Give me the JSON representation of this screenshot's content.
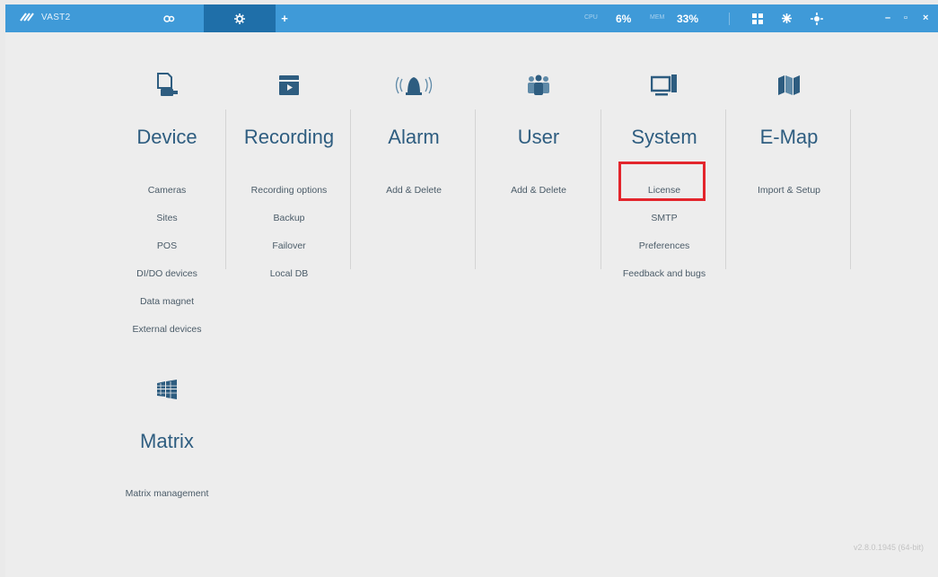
{
  "titlebar": {
    "app_name": "VAST2",
    "cpu_label": "CPU",
    "cpu_value": "6%",
    "mem_label": "MEM",
    "mem_value": "33%",
    "minimize": "–",
    "maximize": "▫",
    "close": "×"
  },
  "sections": [
    {
      "title": "Device",
      "icon": "device-icon",
      "items": [
        "Cameras",
        "Sites",
        "POS",
        "DI/DO devices",
        "Data magnet",
        "External devices"
      ]
    },
    {
      "title": "Recording",
      "icon": "recording-icon",
      "items": [
        "Recording options",
        "Backup",
        "Failover",
        "Local DB"
      ]
    },
    {
      "title": "Alarm",
      "icon": "alarm-icon",
      "items": [
        "Add & Delete"
      ]
    },
    {
      "title": "User",
      "icon": "user-group-icon",
      "items": [
        "Add & Delete"
      ]
    },
    {
      "title": "System",
      "icon": "monitor-icon",
      "items": [
        "License",
        "SMTP",
        "Preferences",
        "Feedback and bugs"
      ]
    },
    {
      "title": "E-Map",
      "icon": "map-icon",
      "items": [
        "Import & Setup"
      ]
    }
  ],
  "matrix": {
    "title": "Matrix",
    "icon": "matrix-icon",
    "items": [
      "Matrix management"
    ]
  },
  "highlight_color": "#e3252c",
  "version": "v2.8.0.1945 (64-bit)"
}
